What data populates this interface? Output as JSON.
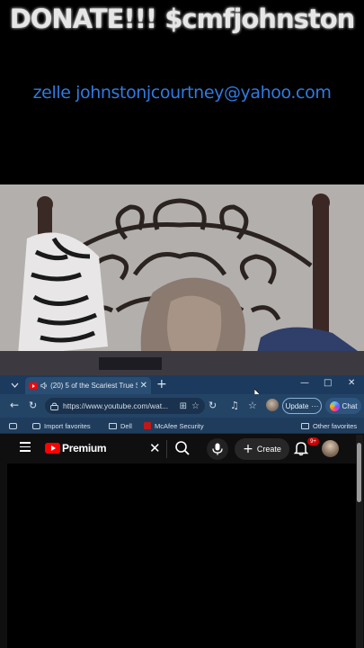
{
  "overlay": {
    "donate_text": "DONATE!!! $cmfjohnston",
    "zelle_text": "zelle johnstonjcourtney@yahoo.com"
  },
  "tab": {
    "title": "(20) 5 of the Scariest True Stories",
    "close": "✕",
    "new_tab": "+"
  },
  "window_controls": {
    "minimize": "—",
    "maximize": "□",
    "close": "✕"
  },
  "address": {
    "url": "https://www.youtube.com/wat...",
    "update_label": "Update",
    "update_more": "···",
    "chat_label": "Chat"
  },
  "favorites": {
    "items": [
      "Import favorites",
      "Dell",
      "McAfee Security"
    ],
    "other": "Other favorites"
  },
  "youtube": {
    "brand": "Premium",
    "clear": "✕",
    "create_label": "Create",
    "create_plus": "+",
    "notification_count": "9+"
  }
}
